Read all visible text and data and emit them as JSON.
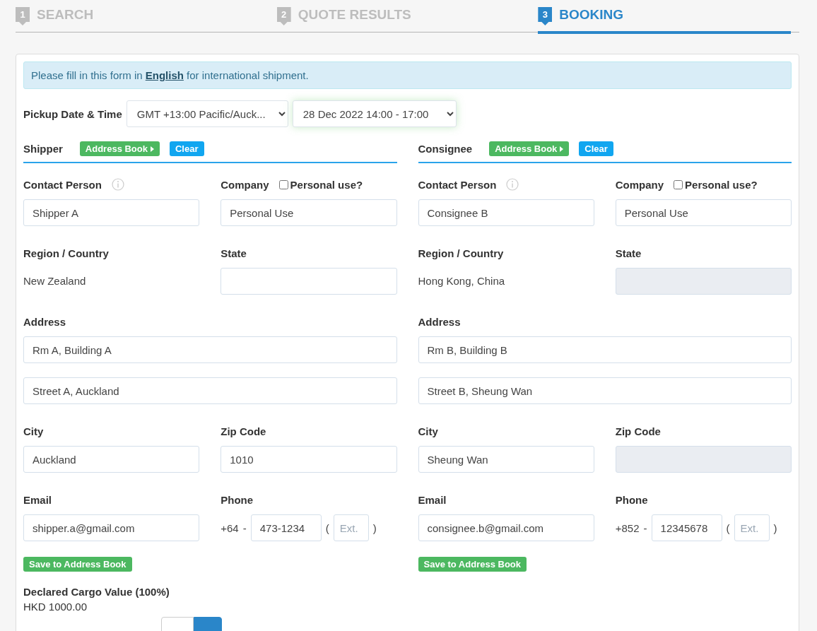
{
  "steps": [
    {
      "number": "1",
      "label": "SEARCH",
      "selected": false
    },
    {
      "number": "2",
      "label": "QUOTE RESULTS",
      "selected": false
    },
    {
      "number": "3",
      "label": "BOOKING",
      "selected": true
    }
  ],
  "notice": {
    "before": "Please fill in this form in ",
    "link": "English",
    "after": " for international shipment."
  },
  "pickup": {
    "label": "Pickup Date & Time",
    "timezone": "GMT +13:00 Pacific/Auck...",
    "slot": "28 Dec 2022 14:00 - 17:00"
  },
  "parties": [
    {
      "title": "Shipper",
      "address_book_button": "Address Book",
      "clear_button": "Clear",
      "contact_label": "Contact Person",
      "contact_value": "Shipper A",
      "company_label": "Company",
      "personal_use_label": "Personal use?",
      "personal_use_checked": false,
      "company_value": "Personal Use",
      "region_label": "Region / Country",
      "region_value": "New Zealand",
      "state_label": "State",
      "state_disabled": false,
      "address_label": "Address",
      "address_lines": [
        "Rm A, Building A",
        "Street A, Auckland"
      ],
      "city_label": "City",
      "city_value": "Auckland",
      "zip_label": "Zip Code",
      "zip_value": "1010",
      "zip_disabled": false,
      "email_label": "Email",
      "email_value": "shipper.a@gmail.com",
      "phone_label": "Phone",
      "phone_code": "+64",
      "phone_separator": "-",
      "phone_value": "473-1234",
      "ext_open": "(",
      "ext_placeholder": "Ext.",
      "ext_close": ")",
      "save_button": "Save to Address Book"
    },
    {
      "title": "Consignee",
      "address_book_button": "Address Book",
      "clear_button": "Clear",
      "contact_label": "Contact Person",
      "contact_value": "Consignee B",
      "company_label": "Company",
      "personal_use_label": "Personal use?",
      "personal_use_checked": false,
      "company_value": "Personal Use",
      "region_label": "Region / Country",
      "region_value": "Hong Kong, China",
      "state_label": "State",
      "state_disabled": true,
      "address_label": "Address",
      "address_lines": [
        "Rm B, Building B",
        "Street B, Sheung Wan"
      ],
      "city_label": "City",
      "city_value": "Sheung Wan",
      "zip_label": "Zip Code",
      "zip_disabled": true,
      "email_label": "Email",
      "email_value": "consignee.b@gmail.com",
      "phone_label": "Phone",
      "phone_code": "+852",
      "phone_separator": "-",
      "phone_value": "12345678",
      "ext_open": "(",
      "ext_placeholder": "Ext.",
      "ext_close": ")",
      "save_button": "Save to Address Book"
    }
  ],
  "declared": {
    "label": "Declared Cargo Value (100%)",
    "value": "HKD 1000.00"
  },
  "toggle": {
    "options": [
      {
        "selected": false
      },
      {
        "selected": true
      }
    ]
  }
}
